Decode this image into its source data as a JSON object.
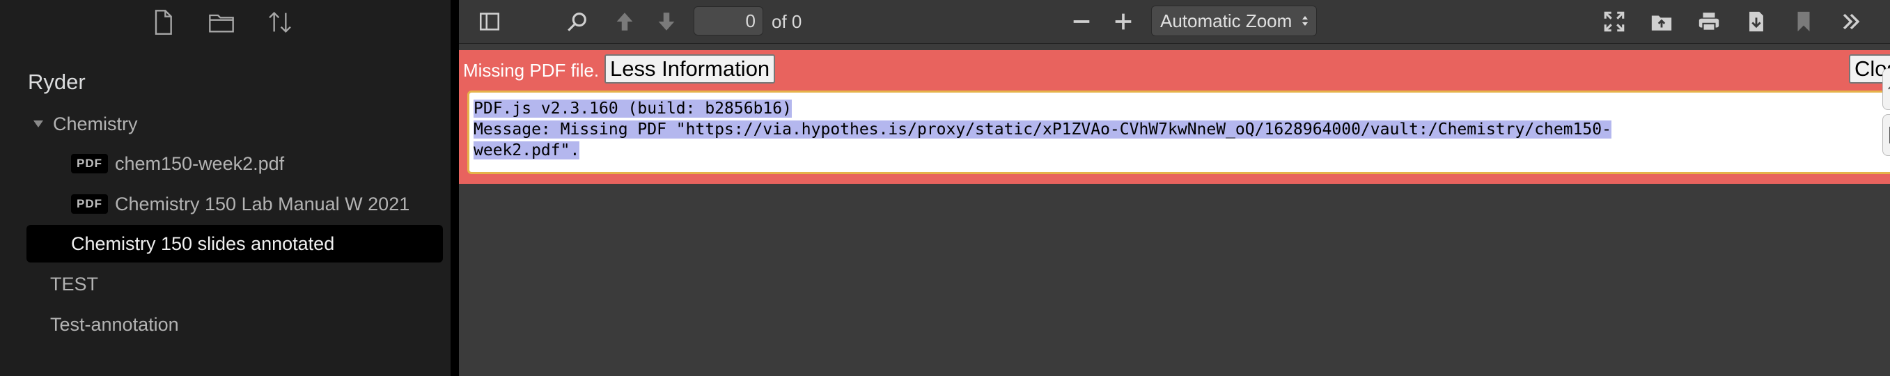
{
  "sidebar": {
    "vault_name": "Ryder",
    "folder_chemistry": "Chemistry",
    "pdf_badge": "PDF",
    "file_1": "chem150-week2.pdf",
    "file_2": "Chemistry 150 Lab Manual W 2021",
    "active_item": "Chemistry 150 slides annotated",
    "folder_test": "TEST",
    "folder_test_annotation": "Test-annotation"
  },
  "toolbar": {
    "page_number": "0",
    "page_count": "of 0",
    "zoom_label": "Automatic Zoom"
  },
  "error": {
    "message": "Missing PDF file.",
    "less_info_label": "Less Information",
    "close_label": "Close",
    "line1": "PDF.js v2.3.160 (build: b2856b16)",
    "line2": "Message: Missing PDF \"https://via.hypothes.is/proxy/static/xP1ZVAo-CVhW7kwNneW_oQ/1628964000/vault:/Chemistry/chem150-",
    "line3": "week2.pdf\"."
  },
  "colors": {
    "error_bar": "#e8635e",
    "selection": "#b4b7ee",
    "sidebar_bg": "#1e1e1e",
    "viewer_bg": "#3b3b3b"
  }
}
